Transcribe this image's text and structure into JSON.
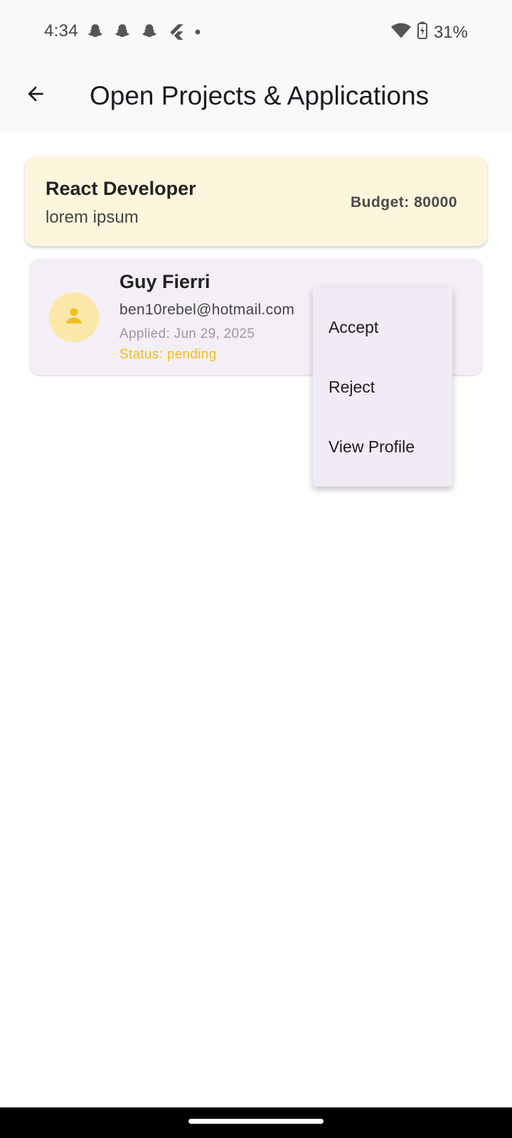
{
  "status_bar": {
    "time": "4:34",
    "battery_percent": "31%",
    "notification_icons": [
      "snapchat-icon",
      "snapchat-icon",
      "snapchat-icon",
      "flutter-icon",
      "dot-icon"
    ],
    "system_icons": [
      "wifi-icon",
      "battery-charging-icon"
    ]
  },
  "app_bar": {
    "title": "Open Projects & Applications",
    "back_icon": "arrow-back-icon"
  },
  "project": {
    "title": "React Developer",
    "description": "lorem ipsum",
    "budget": "Budget: 80000"
  },
  "applicant": {
    "name": "Guy Fierri",
    "email": "ben10rebel@hotmail.com",
    "applied": "Applied: Jun 29, 2025",
    "status": "Status: pending",
    "avatar_icon": "person-icon"
  },
  "menu": {
    "items": [
      {
        "label": "Accept"
      },
      {
        "label": "Reject"
      },
      {
        "label": "View Profile"
      }
    ]
  },
  "colors": {
    "project_card_bg": "#fdf6dd",
    "applicant_card_bg": "#f4eff6",
    "status_pending": "#f2be1c",
    "avatar_bg": "#fbe8a8",
    "menu_bg": "#f1ebf6"
  }
}
